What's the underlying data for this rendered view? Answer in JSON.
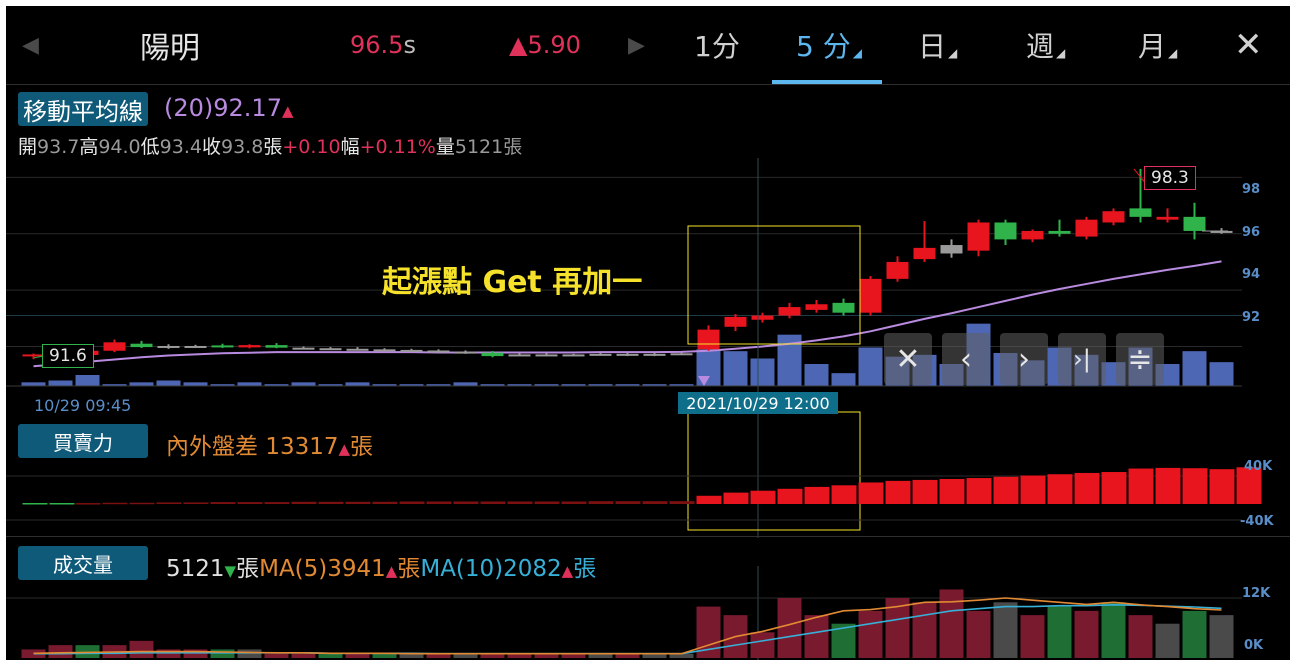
{
  "header": {
    "prev_arrow": "◀",
    "stock_name": "陽明",
    "price": "96.5",
    "price_unit": "s",
    "change_symbol": "▲",
    "change_value": "5.90",
    "next_arrow": "▶",
    "periods": [
      {
        "label": "1分",
        "active": false,
        "corner": ""
      },
      {
        "label": "5 分",
        "active": true,
        "corner": "◢"
      },
      {
        "label": "日",
        "active": false,
        "corner": "◢"
      },
      {
        "label": "週",
        "active": false,
        "corner": "◢"
      },
      {
        "label": "月",
        "active": false,
        "corner": "◢"
      }
    ],
    "close_label": "✕"
  },
  "price_panel": {
    "badge": "移動平均線",
    "ma_value": "(20)92.17",
    "ma_arrow": "▲",
    "open_label": "開",
    "open": "93.7",
    "high_label": "高",
    "high": "94.0",
    "low_label": "低",
    "low": "93.4",
    "close_label": "收",
    "close": "93.8",
    "chg_label": "張",
    "chg": "+0.10",
    "pct_label": "幅",
    "pct": "+0.11%",
    "vol_label": "量",
    "vol": "5121",
    "vol_unit": "張",
    "y_ticks": [
      "98",
      "96",
      "94",
      "92"
    ],
    "high_marker": "98.3",
    "low_marker": "91.6"
  },
  "annotation": "起漲點 Get 再加一",
  "toolbar": {
    "close": "✕",
    "prev": "‹",
    "next": "›",
    "last": "›|",
    "menu": "≑"
  },
  "time_axis": {
    "left_time": "10/29 09:45",
    "cursor_time": "2021/10/29 12:00"
  },
  "buysell_panel": {
    "badge": "買賣力",
    "label": "內外盤差",
    "value": "13317",
    "arrow": "▲",
    "unit": "張",
    "y_ticks": [
      "40K",
      "-40K"
    ]
  },
  "volume_panel": {
    "badge": "成交量",
    "value": "5121",
    "value_arrow": "▼",
    "unit": "張",
    "ma5_label": "MA(5)3941",
    "ma5_arrow": "▲",
    "ma5_unit": "張",
    "ma10_label": "MA(10)2082",
    "ma10_arrow": "▲",
    "ma10_unit": "張",
    "y_ticks": [
      "12K",
      "0K"
    ]
  },
  "colors": {
    "up": "#e8141e",
    "down": "#2fb34a",
    "flat": "#9a9a9a",
    "ma_line": "#b98be0",
    "accent": "#5db7ee",
    "highlight": "#f6e22a"
  },
  "chart_data": {
    "type": "candlestick",
    "x_start": "10/29 09:45",
    "x_cursor": "2021/10/29 12:00",
    "ylim": [
      90.6,
      98.9
    ],
    "candles": [
      {
        "o": 91.65,
        "h": 91.75,
        "l": 91.55,
        "c": 91.72,
        "d": "up"
      },
      {
        "o": 91.72,
        "h": 91.76,
        "l": 91.6,
        "c": 91.68,
        "d": "flat"
      },
      {
        "o": 91.7,
        "h": 92.0,
        "l": 91.65,
        "c": 91.85,
        "d": "up"
      },
      {
        "o": 91.85,
        "h": 92.25,
        "l": 91.8,
        "c": 92.15,
        "d": "up"
      },
      {
        "o": 92.1,
        "h": 92.2,
        "l": 91.95,
        "c": 91.98,
        "d": "down"
      },
      {
        "o": 92.0,
        "h": 92.08,
        "l": 91.92,
        "c": 92.02,
        "d": "flat"
      },
      {
        "o": 92.0,
        "h": 92.06,
        "l": 91.96,
        "c": 92.02,
        "d": "flat"
      },
      {
        "o": 92.04,
        "h": 92.1,
        "l": 91.95,
        "c": 91.97,
        "d": "down"
      },
      {
        "o": 91.97,
        "h": 92.08,
        "l": 91.94,
        "c": 92.05,
        "d": "up"
      },
      {
        "o": 92.05,
        "h": 92.12,
        "l": 91.94,
        "c": 91.96,
        "d": "down"
      },
      {
        "o": 91.96,
        "h": 92.0,
        "l": 91.9,
        "c": 91.94,
        "d": "flat"
      },
      {
        "o": 91.94,
        "h": 91.98,
        "l": 91.88,
        "c": 91.92,
        "d": "flat"
      },
      {
        "o": 91.92,
        "h": 91.98,
        "l": 91.86,
        "c": 91.9,
        "d": "flat"
      },
      {
        "o": 91.9,
        "h": 91.94,
        "l": 91.84,
        "c": 91.88,
        "d": "flat"
      },
      {
        "o": 91.88,
        "h": 91.92,
        "l": 91.82,
        "c": 91.86,
        "d": "flat"
      },
      {
        "o": 91.86,
        "h": 91.9,
        "l": 91.78,
        "c": 91.82,
        "d": "flat"
      },
      {
        "o": 91.82,
        "h": 91.86,
        "l": 91.74,
        "c": 91.78,
        "d": "flat"
      },
      {
        "o": 91.78,
        "h": 91.84,
        "l": 91.62,
        "c": 91.66,
        "d": "down"
      },
      {
        "o": 91.7,
        "h": 91.76,
        "l": 91.68,
        "c": 91.72,
        "d": "flat"
      },
      {
        "o": 91.72,
        "h": 91.76,
        "l": 91.66,
        "c": 91.7,
        "d": "flat"
      },
      {
        "o": 91.7,
        "h": 91.74,
        "l": 91.66,
        "c": 91.72,
        "d": "flat"
      },
      {
        "o": 91.72,
        "h": 91.78,
        "l": 91.68,
        "c": 91.74,
        "d": "flat"
      },
      {
        "o": 91.74,
        "h": 91.78,
        "l": 91.66,
        "c": 91.7,
        "d": "flat"
      },
      {
        "o": 91.7,
        "h": 91.78,
        "l": 91.66,
        "c": 91.74,
        "d": "flat"
      },
      {
        "o": 91.74,
        "h": 91.8,
        "l": 91.7,
        "c": 91.76,
        "d": "flat"
      },
      {
        "o": 91.9,
        "h": 92.75,
        "l": 91.85,
        "c": 92.6,
        "d": "up"
      },
      {
        "o": 92.7,
        "h": 93.15,
        "l": 92.55,
        "c": 93.05,
        "d": "up"
      },
      {
        "o": 92.95,
        "h": 93.2,
        "l": 92.85,
        "c": 93.1,
        "d": "up"
      },
      {
        "o": 93.1,
        "h": 93.55,
        "l": 93.0,
        "c": 93.4,
        "d": "up"
      },
      {
        "o": 93.3,
        "h": 93.65,
        "l": 93.2,
        "c": 93.5,
        "d": "up"
      },
      {
        "o": 93.2,
        "h": 93.7,
        "l": 93.1,
        "c": 93.55,
        "d": "down"
      },
      {
        "o": 93.2,
        "h": 94.5,
        "l": 93.1,
        "c": 94.4,
        "d": "up"
      },
      {
        "o": 94.4,
        "h": 95.2,
        "l": 94.3,
        "c": 95.0,
        "d": "up"
      },
      {
        "o": 95.1,
        "h": 96.45,
        "l": 95.0,
        "c": 95.5,
        "d": "up"
      },
      {
        "o": 95.3,
        "h": 95.8,
        "l": 95.15,
        "c": 95.6,
        "d": "flat"
      },
      {
        "o": 95.4,
        "h": 96.5,
        "l": 95.2,
        "c": 96.4,
        "d": "up"
      },
      {
        "o": 96.4,
        "h": 96.5,
        "l": 95.6,
        "c": 95.8,
        "d": "down"
      },
      {
        "o": 95.8,
        "h": 96.15,
        "l": 95.7,
        "c": 96.1,
        "d": "up"
      },
      {
        "o": 96.1,
        "h": 96.5,
        "l": 95.9,
        "c": 96.0,
        "d": "down"
      },
      {
        "o": 95.9,
        "h": 96.6,
        "l": 95.8,
        "c": 96.5,
        "d": "up"
      },
      {
        "o": 96.4,
        "h": 96.9,
        "l": 96.3,
        "c": 96.8,
        "d": "up"
      },
      {
        "o": 96.9,
        "h": 98.3,
        "l": 96.4,
        "c": 96.6,
        "d": "down"
      },
      {
        "o": 96.6,
        "h": 96.9,
        "l": 96.4,
        "c": 96.5,
        "d": "up"
      },
      {
        "o": 96.6,
        "h": 97.1,
        "l": 95.8,
        "c": 96.1,
        "d": "down"
      },
      {
        "o": 96.1,
        "h": 96.2,
        "l": 96.0,
        "c": 96.1,
        "d": "flat"
      }
    ],
    "ma20": [
      91.3,
      91.38,
      91.46,
      91.54,
      91.62,
      91.68,
      91.72,
      91.76,
      91.78,
      91.8,
      91.8,
      91.8,
      91.8,
      91.8,
      91.8,
      91.79,
      91.79,
      91.79,
      91.79,
      91.79,
      91.79,
      91.8,
      91.8,
      91.8,
      91.81,
      91.85,
      91.92,
      92.0,
      92.1,
      92.22,
      92.36,
      92.54,
      92.76,
      92.98,
      93.18,
      93.4,
      93.62,
      93.84,
      94.04,
      94.22,
      94.4,
      94.56,
      94.72,
      94.86,
      95.02
    ],
    "price_volume": [
      2,
      3,
      6,
      1,
      2,
      3,
      2,
      1,
      2,
      1,
      2,
      1,
      2,
      1,
      1,
      1,
      2,
      1,
      1,
      1,
      1,
      1,
      1,
      1,
      1,
      20,
      19,
      15,
      28,
      12,
      7,
      21,
      16,
      17,
      12,
      34,
      18,
      14,
      21,
      17,
      13,
      21,
      12,
      19,
      13
    ],
    "buysell": [
      0.2,
      0.2,
      0.3,
      0.4,
      0.4,
      0.5,
      0.5,
      0.6,
      0.6,
      0.6,
      0.7,
      0.7,
      0.7,
      0.7,
      0.8,
      0.8,
      0.8,
      0.8,
      0.8,
      0.8,
      0.8,
      0.9,
      0.9,
      0.9,
      0.9,
      2.6,
      3.6,
      4.2,
      4.8,
      5.4,
      5.9,
      6.8,
      7.3,
      7.6,
      7.9,
      8.2,
      8.6,
      9.0,
      9.4,
      9.8,
      10.1,
      11.2,
      11.4,
      11.3,
      11.0,
      11.6
    ],
    "volume": {
      "values": [
        2,
        3,
        3,
        3,
        4,
        2,
        2,
        2,
        2,
        1,
        1,
        1,
        1,
        1,
        1,
        1,
        1,
        1,
        1,
        1,
        1,
        1,
        1,
        1,
        1,
        12,
        10,
        6,
        14,
        10,
        8,
        11,
        14,
        13,
        16,
        11,
        13,
        10,
        12,
        11,
        13,
        10,
        8,
        11,
        10
      ],
      "dirs": [
        "up",
        "up",
        "down",
        "up",
        "up",
        "up",
        "up",
        "down",
        "flat",
        "up",
        "up",
        "down",
        "up",
        "down",
        "flat",
        "up",
        "flat",
        "up",
        "up",
        "up",
        "up",
        "flat",
        "up",
        "flat",
        "flat",
        "up",
        "up",
        "up",
        "up",
        "up",
        "down",
        "up",
        "up",
        "up",
        "up",
        "up",
        "flat",
        "up",
        "down",
        "up",
        "down",
        "up",
        "flat",
        "down",
        "flat"
      ],
      "ma5": [
        1.1,
        1.2,
        1.3,
        1.4,
        1.5,
        1.5,
        1.5,
        1.4,
        1.3,
        1.2,
        1.2,
        1.1,
        1.1,
        1.1,
        1.0,
        1.0,
        1.0,
        1.0,
        1.0,
        1.0,
        1.0,
        1.0,
        1.0,
        1.0,
        1.0,
        3.0,
        5.0,
        6.2,
        7.8,
        9.5,
        11.0,
        11.3,
        12.0,
        13.0,
        13.1,
        13.5,
        14.0,
        13.5,
        13.0,
        12.5,
        13.0,
        12.4,
        12.0,
        11.5,
        11.2
      ],
      "ma10": [
        1.0,
        1.0,
        1.1,
        1.1,
        1.2,
        1.2,
        1.2,
        1.2,
        1.2,
        1.2,
        1.2,
        1.1,
        1.1,
        1.1,
        1.1,
        1.0,
        1.0,
        1.0,
        1.0,
        1.0,
        1.0,
        1.0,
        1.0,
        1.0,
        1.0,
        2.0,
        3.0,
        4.0,
        5.0,
        6.0,
        7.0,
        8.0,
        9.0,
        10.0,
        11.0,
        11.5,
        12.0,
        12.0,
        12.2,
        12.2,
        12.4,
        12.3,
        12.1,
        11.9,
        11.6
      ],
      "ylim": [
        0,
        14
      ]
    }
  }
}
